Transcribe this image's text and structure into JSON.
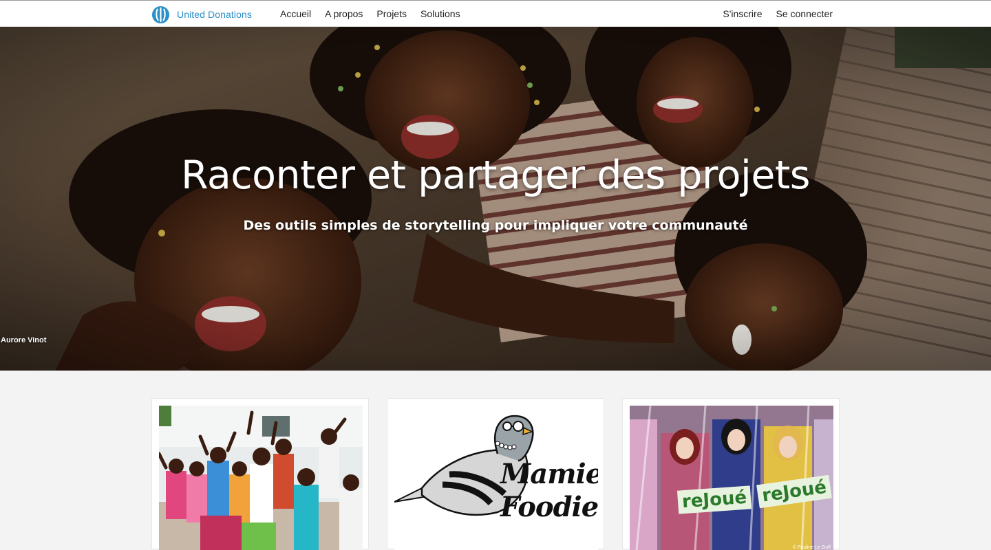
{
  "header": {
    "brand_name": "United Donations",
    "logo_icon": "united-donations-logo-icon",
    "brand_color": "#2b8fc8",
    "nav_main": [
      "Accueil",
      "A propos",
      "Projets",
      "Solutions"
    ],
    "nav_right": [
      "S'inscrire",
      "Se connecter"
    ]
  },
  "hero": {
    "title": "Raconter et partager des projets",
    "subtitle": "Des outils simples de storytelling pour impliquer votre communauté",
    "photo_credit": "Aurore Vinot"
  },
  "projects": [
    {
      "image": "children-group-photo"
    },
    {
      "image": "mamie-foodie-pigeon-logo",
      "logo_text_line1": "Mamie",
      "logo_text_line2": "Foodie"
    },
    {
      "image": "dolls-in-packaging-photo",
      "tag_text": "reJoué",
      "credit": "© Pauline Le Goff"
    }
  ]
}
